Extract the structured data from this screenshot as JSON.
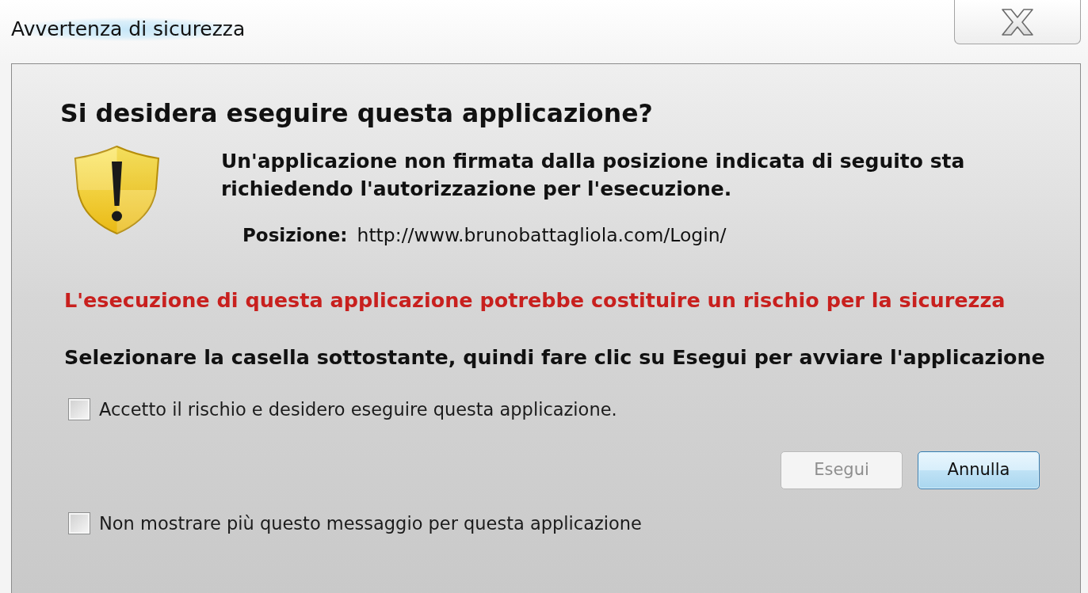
{
  "window": {
    "title": "Avvertenza di sicurezza"
  },
  "dialog": {
    "heading": "Si desidera eseguire questa applicazione?",
    "message": "Un'applicazione non firmata dalla posizione indicata di seguito sta richiedendo l'autorizzazione per l'esecuzione.",
    "location": {
      "label": "Posizione:",
      "value": "http://www.brunobattagliola.com/Login/"
    },
    "warning": "L'esecuzione di questa applicazione potrebbe costituire un rischio per la sicurezza",
    "instruction": "Selezionare la casella sottostante, quindi fare clic su Esegui per avviare l'applicazione",
    "accept_checkbox": {
      "label": "Accetto il rischio e desidero eseguire questa applicazione.",
      "checked": false
    },
    "buttons": [
      {
        "label": "Esegui",
        "disabled": true,
        "focused": false
      },
      {
        "label": "Annulla",
        "disabled": false,
        "focused": true
      }
    ],
    "hide_checkbox": {
      "label": "Non mostrare più questo messaggio per questa applicazione",
      "checked": false
    }
  }
}
